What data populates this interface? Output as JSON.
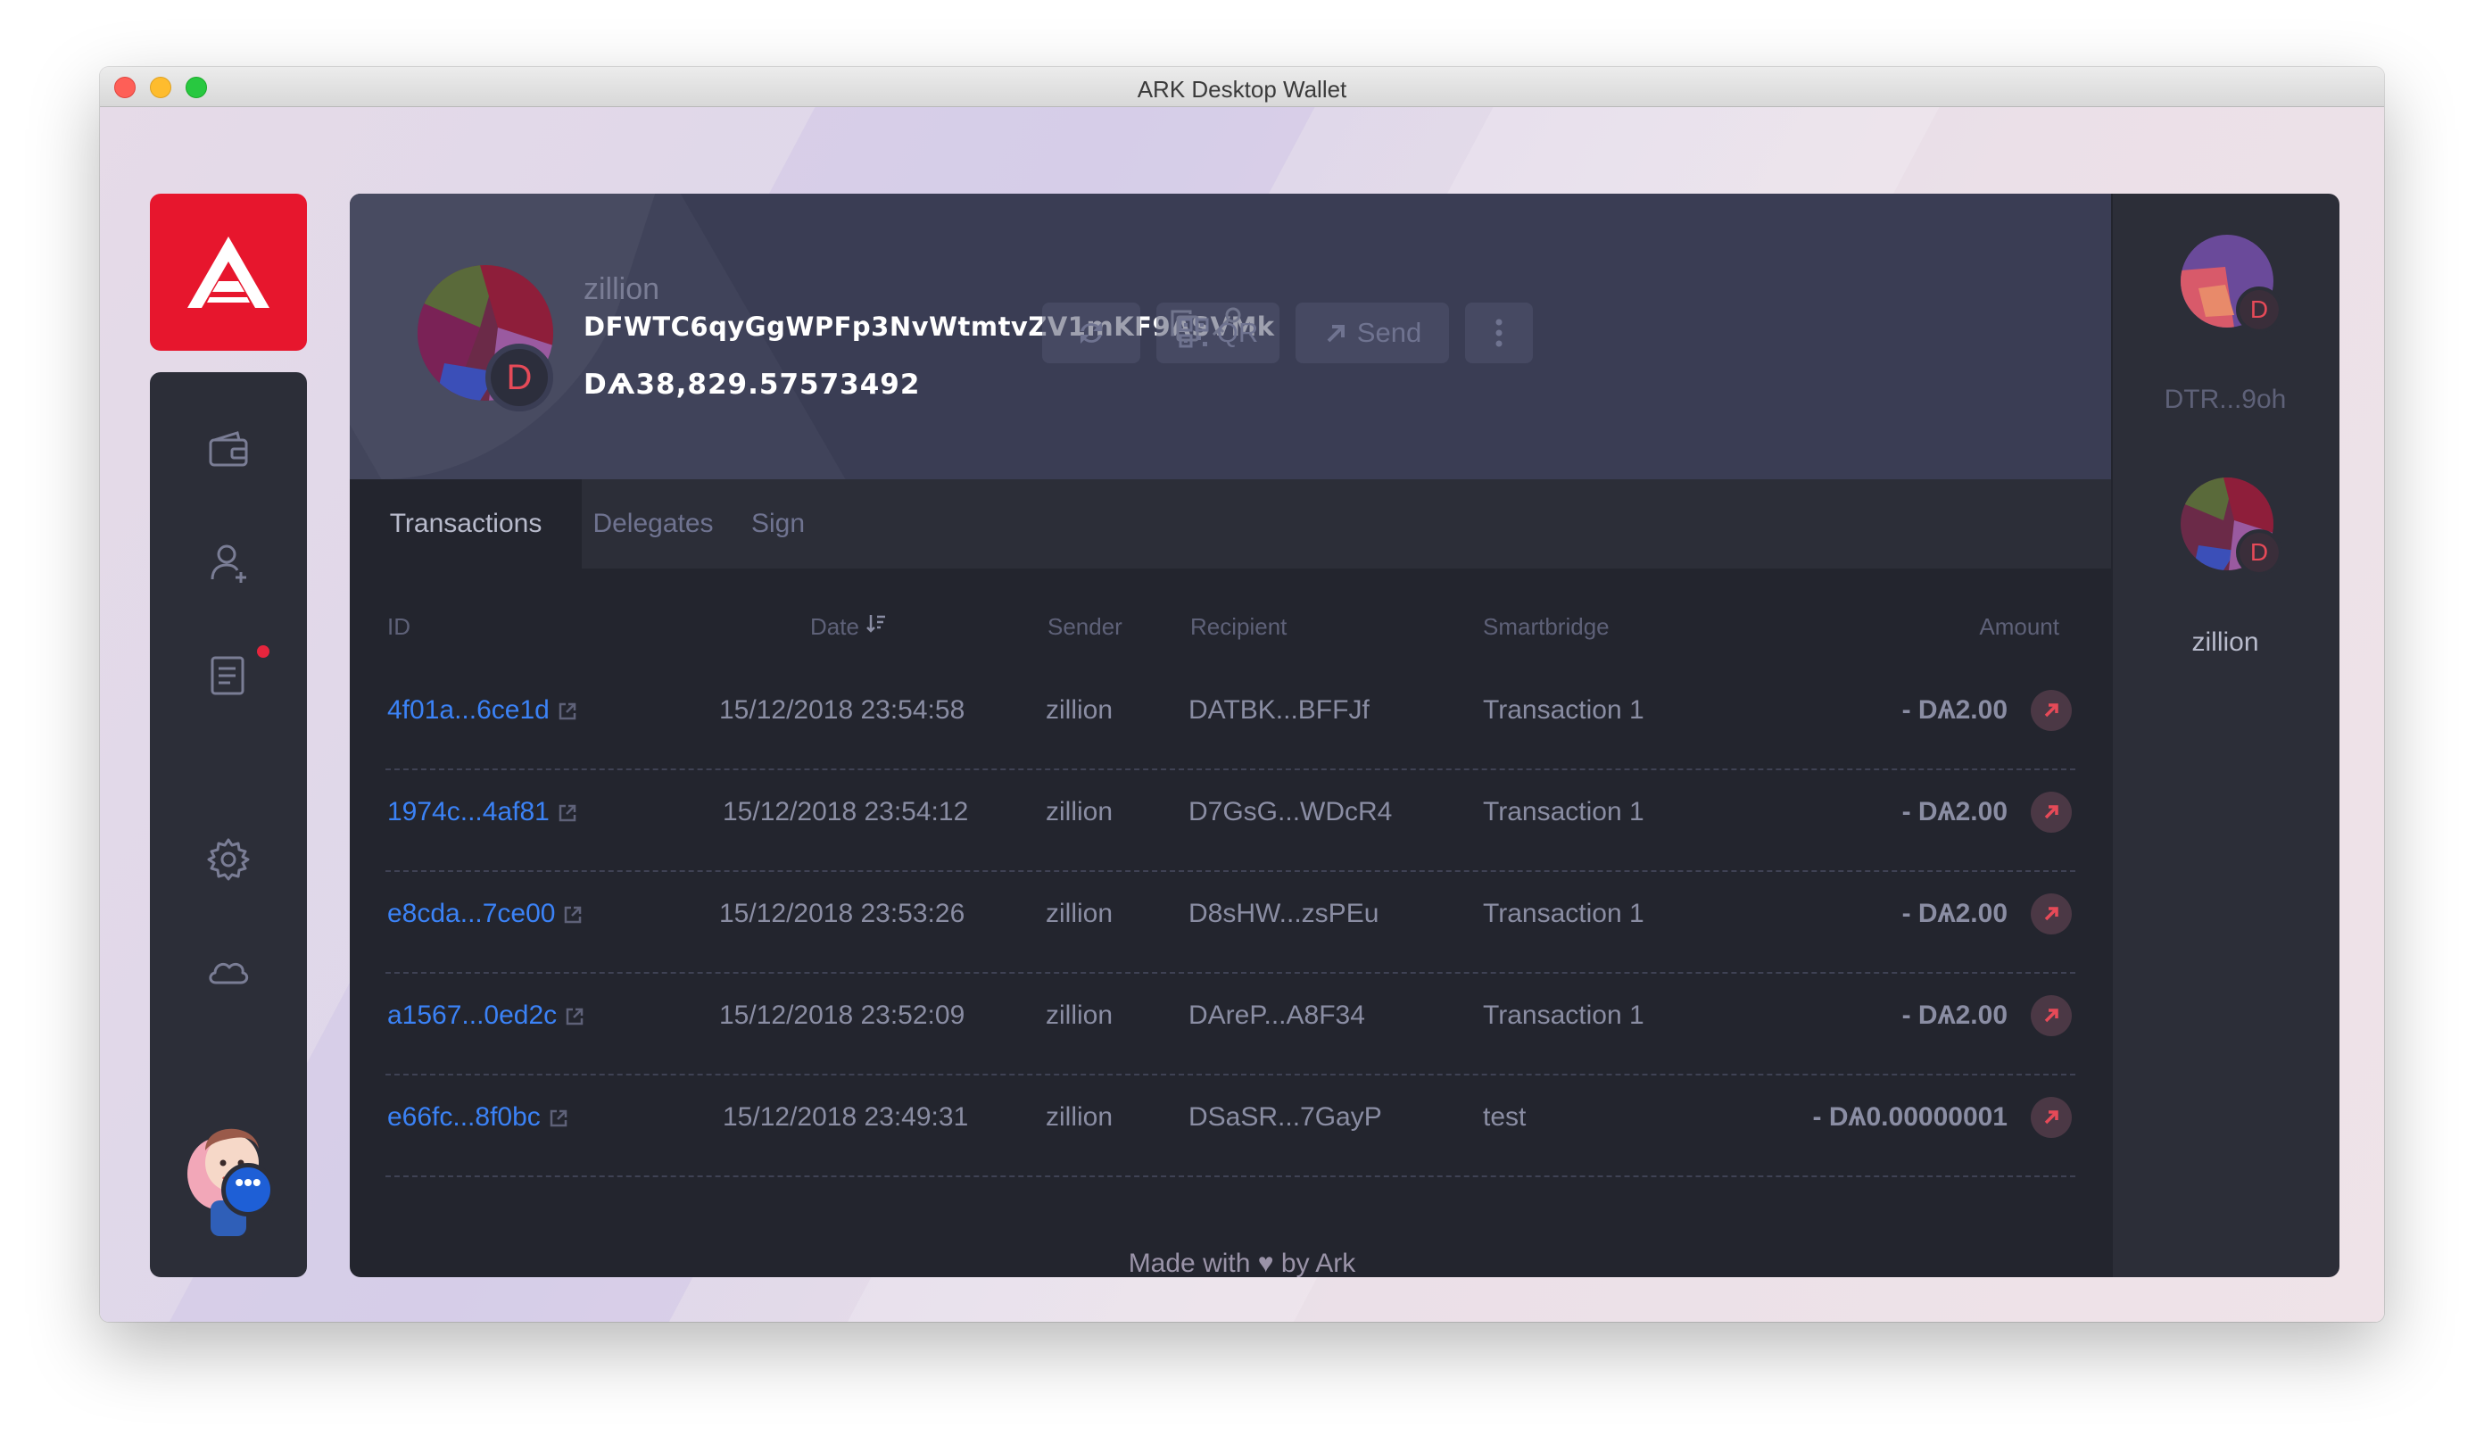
{
  "window": {
    "title": "ARK Desktop Wallet"
  },
  "wallet": {
    "name": "zillion",
    "address": "DFWTC6qyGgWPFp3NvWtmtvZV1mKF9ASVMk",
    "balance": "DѦ38,829.57573492",
    "avatar_letter": "D"
  },
  "actions": {
    "qr_label": "QR",
    "send_label": "Send"
  },
  "tabs": [
    {
      "label": "Transactions",
      "active": true
    },
    {
      "label": "Delegates",
      "active": false
    },
    {
      "label": "Sign",
      "active": false
    }
  ],
  "table": {
    "headers": [
      "ID",
      "Date",
      "Sender",
      "Recipient",
      "Smartbridge",
      "Amount"
    ],
    "rows": [
      {
        "id": "4f01a...6ce1d",
        "date": "15/12/2018 23:54:58",
        "sender": "zillion",
        "recipient": "DATBK...BFFJf",
        "smartbridge": "Transaction 1",
        "amount": "- DѦ2.00"
      },
      {
        "id": "1974c...4af81",
        "date": "15/12/2018 23:54:12",
        "sender": "zillion",
        "recipient": "D7GsG...WDcR4",
        "smartbridge": "Transaction 1",
        "amount": "- DѦ2.00"
      },
      {
        "id": "e8cda...7ce00",
        "date": "15/12/2018 23:53:26",
        "sender": "zillion",
        "recipient": "D8sHW...zsPEu",
        "smartbridge": "Transaction 1",
        "amount": "- DѦ2.00"
      },
      {
        "id": "a1567...0ed2c",
        "date": "15/12/2018 23:52:09",
        "sender": "zillion",
        "recipient": "DAreP...A8F34",
        "smartbridge": "Transaction 1",
        "amount": "- DѦ2.00"
      },
      {
        "id": "e66fc...8f0bc",
        "date": "15/12/2018 23:49:31",
        "sender": "zillion",
        "recipient": "DSaSR...7GayP",
        "smartbridge": "test",
        "amount": "- DѦ0.00000001"
      }
    ]
  },
  "sidebar_wallets": [
    {
      "name": "DTR...9oh",
      "avatar_letter": "D"
    },
    {
      "name": "zillion",
      "avatar_letter": "D"
    }
  ],
  "footer": {
    "prefix": "Made with",
    "heart": "♥",
    "suffix": "by Ark"
  },
  "colors": {
    "brand_red": "#e7162d",
    "link_blue": "#3b82f6",
    "panel_dark": "#23252e",
    "header_bg": "#3a3d54"
  },
  "icons": {
    "nav": [
      "wallet-icon",
      "contact-add-icon",
      "announcements-icon",
      "settings-icon",
      "network-cloud-icon"
    ],
    "header": [
      "copy-icon",
      "key-icon",
      "refresh-icon",
      "qr-icon",
      "send-arrow-icon",
      "more-vertical-icon"
    ]
  }
}
